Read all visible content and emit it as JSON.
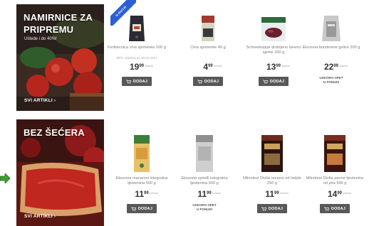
{
  "sections": [
    {
      "banner": {
        "title": "NAMIRNICE ZA PRIPREMU",
        "subtitle": "Uštede i do 40%!",
        "link": "SVI ARTIKLI"
      },
      "ribbon": "% AKCIJA",
      "products": [
        {
          "name": "Fertitecnica chia sjemenke 200 g",
          "old_price": "MPC vrijedna do 28.02.2017",
          "price_main": "19",
          "price_cents": "99",
          "unit": "kn/kom",
          "button": "DODAJ"
        },
        {
          "name": "Chia sjemenke 40 g",
          "old_price": "",
          "price_main": "4",
          "price_cents": "99",
          "unit": "kn/kom",
          "button": "DODAJ"
        },
        {
          "name": "Schneekoppe drobljeno laneno sjeme 200 g",
          "old_price": "",
          "price_main": "13",
          "price_cents": "99",
          "unit": "kn/kom",
          "button": "DODAJ"
        },
        {
          "name": "Ekozona bundevine golice 200 g",
          "old_price": "",
          "price_main": "22",
          "price_cents": "99",
          "unit": "kn/kom",
          "unavailable": "USKORO OPET U PONUDI"
        }
      ]
    },
    {
      "banner": {
        "title": "BEZ ŠEĆERA",
        "subtitle": "",
        "link": "SVI ARTIKLI"
      },
      "products": [
        {
          "name": "Ekozona macaroni integralna tjestenina 500 g",
          "old_price": "",
          "price_main": "11",
          "price_cents": "99",
          "unit": "kn/kom",
          "button": "DODAJ"
        },
        {
          "name": "Ekozona spirelli integralna tjestenina 500 g",
          "old_price": "",
          "price_main": "11",
          "price_cents": "99",
          "unit": "kn/kom",
          "unavailable": "USKORO OPET U PONUDI"
        },
        {
          "name": "Mlinotest Divita rezanci od heljde 250 g",
          "old_price": "",
          "price_main": "11",
          "price_cents": "99",
          "unit": "kn/kom",
          "button": "DODAJ"
        },
        {
          "name": "Mlinotest Divita penne tjestenina od pira 500 g",
          "old_price": "",
          "price_main": "14",
          "price_cents": "99",
          "unit": "kn/kom",
          "button": "DODAJ"
        }
      ]
    }
  ],
  "colors": {
    "button": "#585858",
    "ribbon": "#2d5fd2",
    "arrow": "#3fa22b"
  }
}
